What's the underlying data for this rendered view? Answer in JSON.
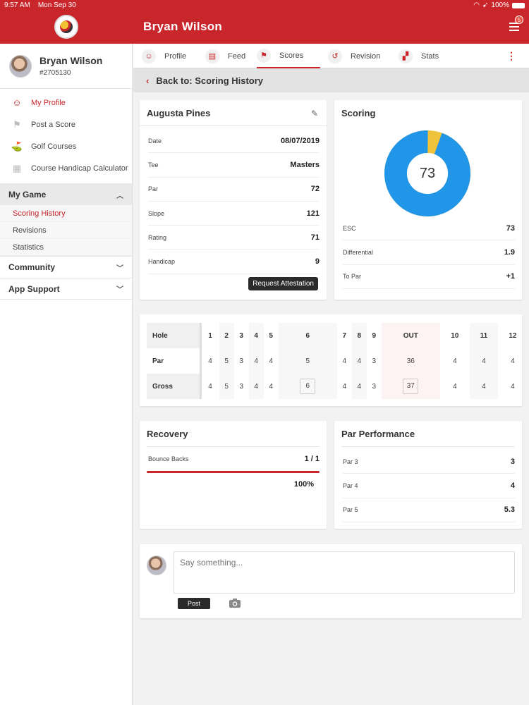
{
  "status": {
    "time": "9:57 AM",
    "date": "Mon Sep 30",
    "battery": "100%"
  },
  "header": {
    "title": "Bryan Wilson",
    "notification_count": "5"
  },
  "sidebar": {
    "name": "Bryan Wilson",
    "member_id": "#2705130",
    "nav": [
      {
        "label": "My Profile",
        "icon": "profile-icon"
      },
      {
        "label": "Post a Score",
        "icon": "flag-icon"
      },
      {
        "label": "Golf Courses",
        "icon": "golf-flag-icon"
      },
      {
        "label": "Course Handicap Calculator",
        "icon": "grid-icon"
      }
    ],
    "sections": {
      "my_game": "My Game",
      "my_game_items": [
        "Scoring History",
        "Revisions",
        "Statistics"
      ],
      "community": "Community",
      "app_support": "App Support"
    }
  },
  "tabs": [
    "Profile",
    "Feed",
    "Scores",
    "Revision",
    "Stats"
  ],
  "back": "Back to: Scoring History",
  "round": {
    "course": "Augusta Pines",
    "rows": [
      {
        "label": "Date",
        "value": "08/07/2019"
      },
      {
        "label": "Tee",
        "value": "Masters"
      },
      {
        "label": "Par",
        "value": "72"
      },
      {
        "label": "Slope",
        "value": "121"
      },
      {
        "label": "Rating",
        "value": "71"
      },
      {
        "label": "Handicap",
        "value": "9"
      }
    ],
    "request_button": "Request Attestation"
  },
  "scoring": {
    "title": "Scoring",
    "donut_value": "73",
    "donut_fraction_blue": 0.945,
    "colors": {
      "primary": "#2196e8",
      "secondary": "#f0c33c"
    },
    "rows": [
      {
        "label": "ESC",
        "value": "73"
      },
      {
        "label": "Differential",
        "value": "1.9"
      },
      {
        "label": "To Par",
        "value": "+1"
      }
    ]
  },
  "scorecard": {
    "labels": {
      "hole": "Hole",
      "par": "Par",
      "gross": "Gross"
    },
    "holes": [
      "1",
      "2",
      "3",
      "4",
      "5",
      "6",
      "7",
      "8",
      "9",
      "OUT",
      "10",
      "11",
      "12"
    ],
    "par": [
      "4",
      "5",
      "3",
      "4",
      "4",
      "5",
      "4",
      "4",
      "3",
      "36",
      "4",
      "4",
      "4"
    ],
    "gross": [
      "4",
      "5",
      "3",
      "4",
      "4",
      "6",
      "4",
      "4",
      "3",
      "37",
      "4",
      "4",
      "4"
    ]
  },
  "recovery": {
    "title": "Recovery",
    "label": "Bounce Backs",
    "value": "1 / 1",
    "percent": "100%",
    "fraction": 1.0
  },
  "par_performance": {
    "title": "Par Performance",
    "rows": [
      {
        "label": "Par 3",
        "value": "3"
      },
      {
        "label": "Par 4",
        "value": "4"
      },
      {
        "label": "Par 5",
        "value": "5.3"
      }
    ]
  },
  "comment": {
    "placeholder": "Say something...",
    "post": "Post"
  },
  "accent_color": "#c8262b"
}
